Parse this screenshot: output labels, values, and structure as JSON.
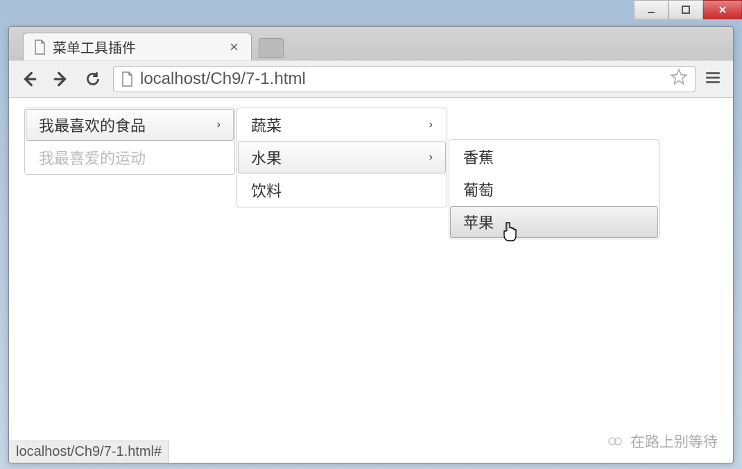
{
  "window": {
    "tab_title": "菜单工具插件",
    "url": "localhost/Ch9/7-1.html"
  },
  "menu_level_1": {
    "items": [
      {
        "label": "我最喜欢的食品",
        "has_submenu": true,
        "state": "selected"
      },
      {
        "label": "我最喜爱的运动",
        "has_submenu": false,
        "state": "disabled"
      }
    ]
  },
  "menu_level_2": {
    "items": [
      {
        "label": "蔬菜",
        "has_submenu": true,
        "state": "normal"
      },
      {
        "label": "水果",
        "has_submenu": true,
        "state": "selected"
      },
      {
        "label": "饮料",
        "has_submenu": false,
        "state": "normal"
      }
    ]
  },
  "menu_level_3": {
    "items": [
      {
        "label": "香蕉",
        "has_submenu": false,
        "state": "normal"
      },
      {
        "label": "葡萄",
        "has_submenu": false,
        "state": "normal"
      },
      {
        "label": "苹果",
        "has_submenu": false,
        "state": "hovered"
      }
    ]
  },
  "status_bar": {
    "text": "localhost/Ch9/7-1.html#"
  },
  "watermark": {
    "text": "在路上别等待"
  },
  "icons": {
    "chevron_right": "›"
  }
}
